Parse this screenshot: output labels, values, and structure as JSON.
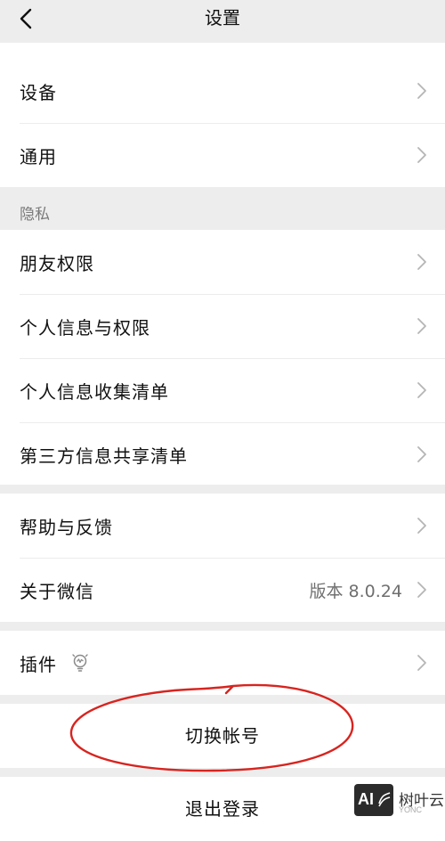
{
  "header": {
    "title": "设置",
    "back_icon": "chevron-left-icon"
  },
  "group_general": {
    "items": [
      {
        "label": "设备"
      },
      {
        "label": "通用"
      }
    ]
  },
  "privacy": {
    "section_title": "隐私",
    "items": [
      {
        "label": "朋友权限"
      },
      {
        "label": "个人信息与权限"
      },
      {
        "label": "个人信息收集清单"
      },
      {
        "label": "第三方信息共享清单"
      }
    ]
  },
  "group_about": {
    "items": [
      {
        "label": "帮助与反馈"
      },
      {
        "label": "关于微信",
        "value": "版本 8.0.24"
      }
    ]
  },
  "group_plugins": {
    "items": [
      {
        "label": "插件",
        "icon": "lightbulb-icon"
      }
    ]
  },
  "actions": {
    "switch_account": "切换帐号",
    "logout": "退出登录"
  },
  "watermark": {
    "logo_text": "AI",
    "site_name": "树叶云",
    "sub": "YONC"
  },
  "colors": {
    "background": "#ededed",
    "cell": "#ffffff",
    "annotation_red": "#d8241f"
  }
}
